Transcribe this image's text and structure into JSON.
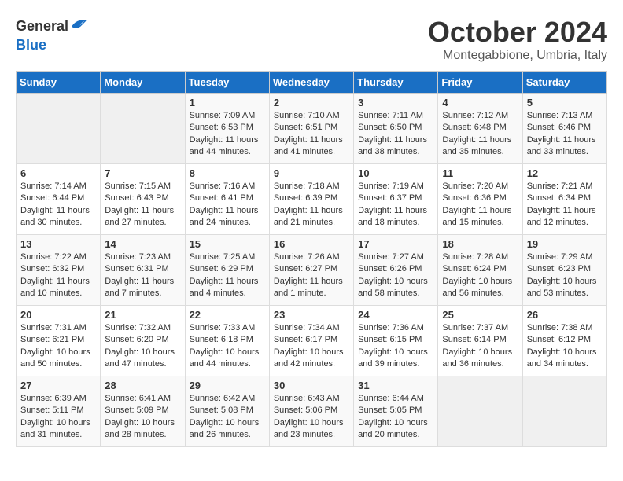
{
  "logo": {
    "general": "General",
    "blue": "Blue"
  },
  "title": "October 2024",
  "location": "Montegabbione, Umbria, Italy",
  "days_header": [
    "Sunday",
    "Monday",
    "Tuesday",
    "Wednesday",
    "Thursday",
    "Friday",
    "Saturday"
  ],
  "weeks": [
    [
      {
        "day": "",
        "info": ""
      },
      {
        "day": "",
        "info": ""
      },
      {
        "day": "1",
        "info": "Sunrise: 7:09 AM\nSunset: 6:53 PM\nDaylight: 11 hours and 44 minutes."
      },
      {
        "day": "2",
        "info": "Sunrise: 7:10 AM\nSunset: 6:51 PM\nDaylight: 11 hours and 41 minutes."
      },
      {
        "day": "3",
        "info": "Sunrise: 7:11 AM\nSunset: 6:50 PM\nDaylight: 11 hours and 38 minutes."
      },
      {
        "day": "4",
        "info": "Sunrise: 7:12 AM\nSunset: 6:48 PM\nDaylight: 11 hours and 35 minutes."
      },
      {
        "day": "5",
        "info": "Sunrise: 7:13 AM\nSunset: 6:46 PM\nDaylight: 11 hours and 33 minutes."
      }
    ],
    [
      {
        "day": "6",
        "info": "Sunrise: 7:14 AM\nSunset: 6:44 PM\nDaylight: 11 hours and 30 minutes."
      },
      {
        "day": "7",
        "info": "Sunrise: 7:15 AM\nSunset: 6:43 PM\nDaylight: 11 hours and 27 minutes."
      },
      {
        "day": "8",
        "info": "Sunrise: 7:16 AM\nSunset: 6:41 PM\nDaylight: 11 hours and 24 minutes."
      },
      {
        "day": "9",
        "info": "Sunrise: 7:18 AM\nSunset: 6:39 PM\nDaylight: 11 hours and 21 minutes."
      },
      {
        "day": "10",
        "info": "Sunrise: 7:19 AM\nSunset: 6:37 PM\nDaylight: 11 hours and 18 minutes."
      },
      {
        "day": "11",
        "info": "Sunrise: 7:20 AM\nSunset: 6:36 PM\nDaylight: 11 hours and 15 minutes."
      },
      {
        "day": "12",
        "info": "Sunrise: 7:21 AM\nSunset: 6:34 PM\nDaylight: 11 hours and 12 minutes."
      }
    ],
    [
      {
        "day": "13",
        "info": "Sunrise: 7:22 AM\nSunset: 6:32 PM\nDaylight: 11 hours and 10 minutes."
      },
      {
        "day": "14",
        "info": "Sunrise: 7:23 AM\nSunset: 6:31 PM\nDaylight: 11 hours and 7 minutes."
      },
      {
        "day": "15",
        "info": "Sunrise: 7:25 AM\nSunset: 6:29 PM\nDaylight: 11 hours and 4 minutes."
      },
      {
        "day": "16",
        "info": "Sunrise: 7:26 AM\nSunset: 6:27 PM\nDaylight: 11 hours and 1 minute."
      },
      {
        "day": "17",
        "info": "Sunrise: 7:27 AM\nSunset: 6:26 PM\nDaylight: 10 hours and 58 minutes."
      },
      {
        "day": "18",
        "info": "Sunrise: 7:28 AM\nSunset: 6:24 PM\nDaylight: 10 hours and 56 minutes."
      },
      {
        "day": "19",
        "info": "Sunrise: 7:29 AM\nSunset: 6:23 PM\nDaylight: 10 hours and 53 minutes."
      }
    ],
    [
      {
        "day": "20",
        "info": "Sunrise: 7:31 AM\nSunset: 6:21 PM\nDaylight: 10 hours and 50 minutes."
      },
      {
        "day": "21",
        "info": "Sunrise: 7:32 AM\nSunset: 6:20 PM\nDaylight: 10 hours and 47 minutes."
      },
      {
        "day": "22",
        "info": "Sunrise: 7:33 AM\nSunset: 6:18 PM\nDaylight: 10 hours and 44 minutes."
      },
      {
        "day": "23",
        "info": "Sunrise: 7:34 AM\nSunset: 6:17 PM\nDaylight: 10 hours and 42 minutes."
      },
      {
        "day": "24",
        "info": "Sunrise: 7:36 AM\nSunset: 6:15 PM\nDaylight: 10 hours and 39 minutes."
      },
      {
        "day": "25",
        "info": "Sunrise: 7:37 AM\nSunset: 6:14 PM\nDaylight: 10 hours and 36 minutes."
      },
      {
        "day": "26",
        "info": "Sunrise: 7:38 AM\nSunset: 6:12 PM\nDaylight: 10 hours and 34 minutes."
      }
    ],
    [
      {
        "day": "27",
        "info": "Sunrise: 6:39 AM\nSunset: 5:11 PM\nDaylight: 10 hours and 31 minutes."
      },
      {
        "day": "28",
        "info": "Sunrise: 6:41 AM\nSunset: 5:09 PM\nDaylight: 10 hours and 28 minutes."
      },
      {
        "day": "29",
        "info": "Sunrise: 6:42 AM\nSunset: 5:08 PM\nDaylight: 10 hours and 26 minutes."
      },
      {
        "day": "30",
        "info": "Sunrise: 6:43 AM\nSunset: 5:06 PM\nDaylight: 10 hours and 23 minutes."
      },
      {
        "day": "31",
        "info": "Sunrise: 6:44 AM\nSunset: 5:05 PM\nDaylight: 10 hours and 20 minutes."
      },
      {
        "day": "",
        "info": ""
      },
      {
        "day": "",
        "info": ""
      }
    ]
  ]
}
